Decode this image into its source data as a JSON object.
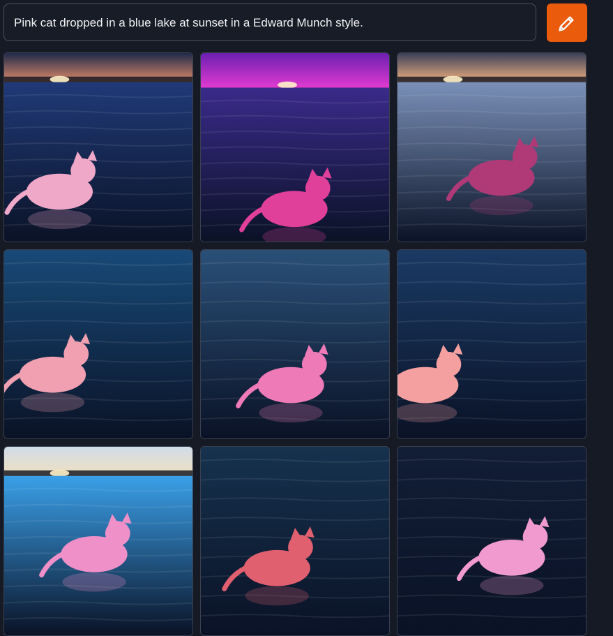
{
  "prompt": {
    "text": "Pink cat dropped in a blue lake at sunset in a Edward Munch style."
  },
  "edit_button": {
    "icon": "pencil-icon",
    "color": "#ea5b0c"
  },
  "results": {
    "columns": 3,
    "images": [
      {
        "id": 1,
        "palette": {
          "sky_top": "#1e2a4a",
          "sky_bottom": "#e08a6a",
          "water": "#203a78",
          "cat": "#f0a8c8"
        },
        "scene": "sunset-horizon",
        "pose": "walking"
      },
      {
        "id": 2,
        "palette": {
          "sky_top": "#6a1fb0",
          "sky_bottom": "#e23ad0",
          "water": "#3a2a8a",
          "cat": "#e0409a"
        },
        "scene": "purple-sunset",
        "pose": "sitting-front"
      },
      {
        "id": 3,
        "palette": {
          "sky_top": "#3a4058",
          "sky_bottom": "#f0b080",
          "water": "#7a90b8",
          "cat": "#b03a78"
        },
        "scene": "treeline-horizon",
        "pose": "sitting-side"
      },
      {
        "id": 4,
        "palette": {
          "sky_top": "#0e2a48",
          "sky_bottom": "#16406a",
          "water": "#184a78",
          "cat": "#f0a0b0"
        },
        "scene": "water-only",
        "pose": "standing-tail-up"
      },
      {
        "id": 5,
        "palette": {
          "sky_top": "#1a3450",
          "sky_bottom": "#2a4e74",
          "water": "#2a5078",
          "cat": "#ee7ab8"
        },
        "scene": "water-only",
        "pose": "lying"
      },
      {
        "id": 6,
        "palette": {
          "sky_top": "#152a4a",
          "sky_bottom": "#1f4470",
          "water": "#1a3a64",
          "cat": "#f4a0a0"
        },
        "scene": "water-only",
        "pose": "looking-up"
      },
      {
        "id": 7,
        "palette": {
          "sky_top": "#d0dce8",
          "sky_bottom": "#f0e0c0",
          "water": "#3aa0e8",
          "cat": "#f090c8"
        },
        "scene": "treeline-bright",
        "pose": "walking"
      },
      {
        "id": 8,
        "palette": {
          "sky_top": "#0e2438",
          "sky_bottom": "#1a3e60",
          "water": "#16324e",
          "cat": "#e06070"
        },
        "scene": "water-only",
        "pose": "sitting-back"
      },
      {
        "id": 9,
        "palette": {
          "sky_top": "#101a30",
          "sky_bottom": "#1a2a48",
          "water": "#121e36",
          "cat": "#f09ad0"
        },
        "scene": "water-only",
        "pose": "sitting-front"
      }
    ]
  }
}
